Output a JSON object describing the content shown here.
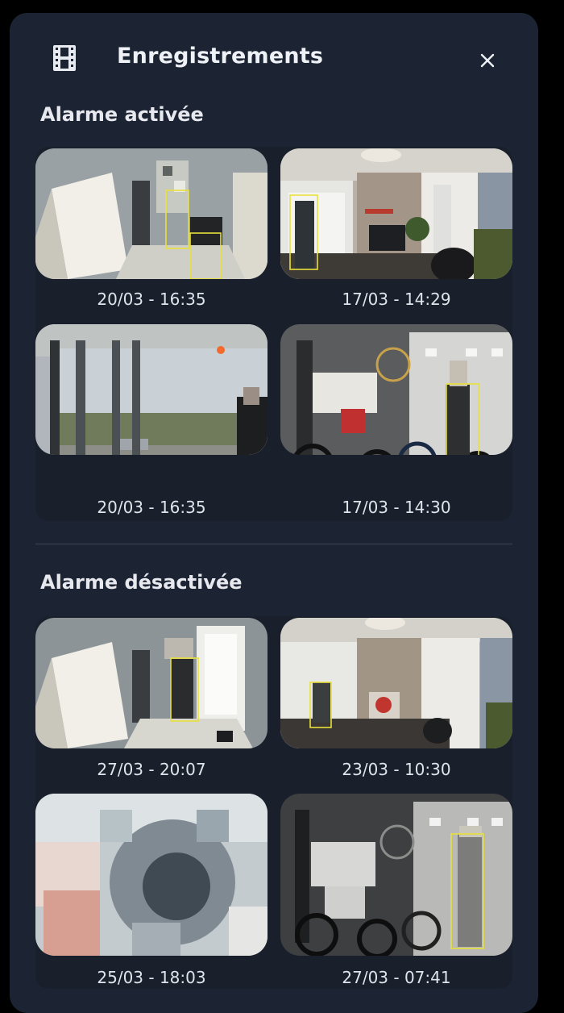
{
  "header": {
    "title": "Enregistrements",
    "film_icon": "film-icon",
    "close_icon": "close-icon"
  },
  "sections": [
    {
      "title": "Alarme activée",
      "recordings": [
        {
          "time": "20/03 - 16:35",
          "scene": "hallway"
        },
        {
          "time": "17/03 - 14:29",
          "scene": "living-room"
        },
        {
          "time": "20/03 - 16:35",
          "scene": "window-door"
        },
        {
          "time": "17/03 - 14:30",
          "scene": "garage"
        }
      ]
    },
    {
      "title": "Alarme désactivée",
      "recordings": [
        {
          "time": "27/03 - 20:07",
          "scene": "hallway"
        },
        {
          "time": "23/03 - 10:30",
          "scene": "living-room"
        },
        {
          "time": "25/03 - 18:03",
          "scene": "blurred"
        },
        {
          "time": "27/03 - 07:41",
          "scene": "garage-night"
        }
      ]
    }
  ],
  "colors": {
    "panel": "#1c2433",
    "group": "#19202c",
    "detection_box": "#e8e03a"
  }
}
